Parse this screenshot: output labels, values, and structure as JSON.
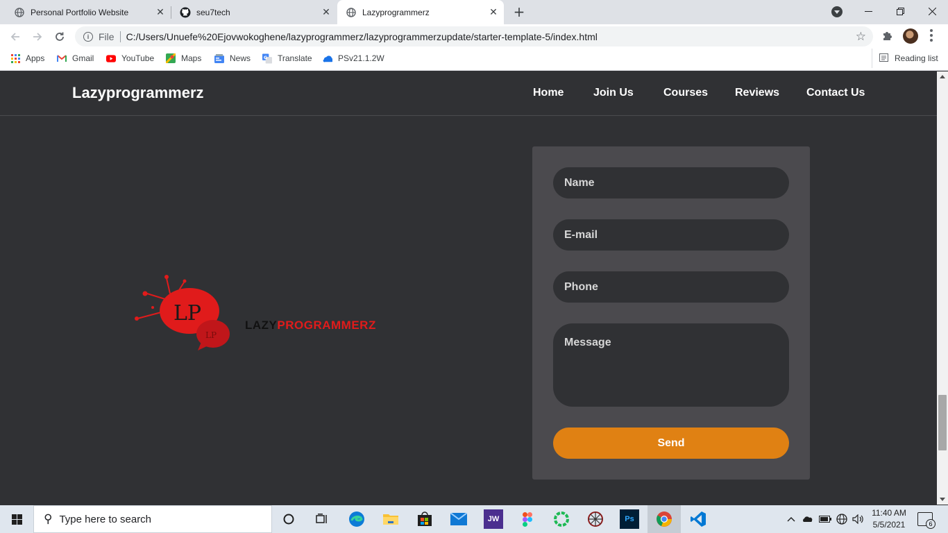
{
  "browser": {
    "tabs": [
      {
        "title": "Personal Portfolio Website",
        "icon": "globe-icon",
        "active": false
      },
      {
        "title": "seu7tech",
        "icon": "github-icon",
        "active": false
      },
      {
        "title": "Lazyprogrammerz",
        "icon": "globe-icon",
        "active": true
      }
    ],
    "close_glyph": "✕",
    "new_tab_glyph": "+",
    "address": {
      "scheme_label": "File",
      "url": "C:/Users/Unuefe%20Ejovwokoghene/lazyprogrammerz/lazyprogrammerzupdate/starter-template-5/index.html"
    },
    "bookmarks": [
      {
        "label": "Apps",
        "icon": "apps-grid-icon"
      },
      {
        "label": "Gmail",
        "icon": "gmail-icon"
      },
      {
        "label": "YouTube",
        "icon": "youtube-icon"
      },
      {
        "label": "Maps",
        "icon": "maps-icon"
      },
      {
        "label": "News",
        "icon": "news-icon"
      },
      {
        "label": "Translate",
        "icon": "translate-icon"
      },
      {
        "label": "PSv21.1.2W",
        "icon": "bookmark-site-icon"
      }
    ],
    "reading_list": "Reading list"
  },
  "site": {
    "brand": "Lazyprogrammerz",
    "nav": [
      "Home",
      "Join Us",
      "Courses",
      "Reviews",
      "Contact Us"
    ],
    "logo": {
      "monogram": "LP",
      "word_dark": "LAZY",
      "word_red": "PROGRAMMERZ",
      "colors": {
        "red": "#e01b1b",
        "dark": "#111111"
      }
    },
    "form": {
      "name_placeholder": "Name",
      "email_placeholder": "E-mail",
      "phone_placeholder": "Phone",
      "message_placeholder": "Message",
      "send_label": "Send"
    },
    "colors": {
      "background": "#303134",
      "card": "#4b4a4e",
      "accent": "#e08113"
    }
  },
  "taskbar": {
    "search_placeholder": "Type here to search",
    "apps": [
      "cortana-icon",
      "task-view-icon",
      "edge-icon",
      "file-explorer-icon",
      "store-icon",
      "mail-icon",
      "jw-app-icon",
      "figma-icon",
      "green-ring-app-icon",
      "web-app-icon",
      "photoshop-icon",
      "chrome-icon",
      "vscode-icon"
    ],
    "jw_label": "JW",
    "ps_label": "Ps",
    "time": "11:40 AM",
    "date": "5/5/2021",
    "notification_count": "6"
  }
}
